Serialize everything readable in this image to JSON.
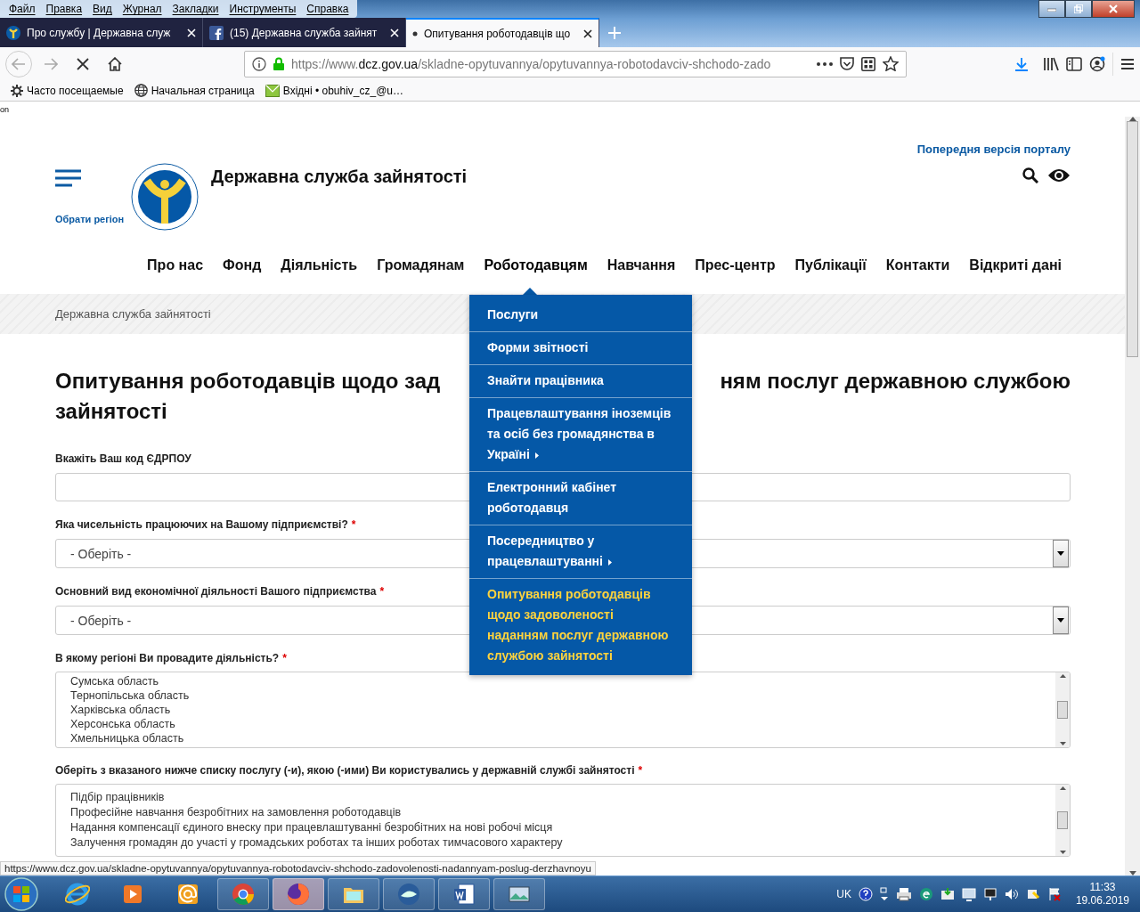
{
  "menu_bar": [
    "Файл",
    "Правка",
    "Вид",
    "Журнал",
    "Закладки",
    "Инструменты",
    "Справка"
  ],
  "browser_tabs": [
    {
      "title": "Про службу | Державна служ",
      "kind": "site",
      "selected": false
    },
    {
      "title": "(15) Державна служба зайнят",
      "kind": "facebook",
      "selected": false
    },
    {
      "title": "Опитування роботодавців що",
      "kind": "loading",
      "selected": true
    }
  ],
  "address_bar": {
    "scheme": "https://www.",
    "domain": "dcz.gov.ua",
    "path": "/skladne-opytuvannya/opytuvannya-robotodavciv-shchodo-zado"
  },
  "bookmarks": [
    {
      "label": "Часто посещаемые",
      "kind": "gear"
    },
    {
      "label": "Начальная страница",
      "kind": "globe"
    },
    {
      "label": "Вхідні • obuhiv_cz_@u…",
      "kind": "mail"
    }
  ],
  "page_corner_text": "on",
  "site": {
    "previous_version_link": "Попередня версія порталу",
    "title": "Державна служба зайнятості",
    "region_link": "Обрати регіон",
    "nav": [
      {
        "label": "Про нас",
        "expanded": false
      },
      {
        "label": "Фонд",
        "expanded": false
      },
      {
        "label": "Діяльність",
        "expanded": false
      },
      {
        "label": "Громадянам",
        "expanded": false
      },
      {
        "label": "Роботодавцям",
        "expanded": true
      },
      {
        "label": "Навчання",
        "expanded": false
      },
      {
        "label": "Прес-центр",
        "expanded": false
      },
      {
        "label": "Публікації",
        "expanded": false
      },
      {
        "label": "Контакти",
        "expanded": false
      },
      {
        "label": "Відкриті дані",
        "expanded": false
      }
    ],
    "breadcrumb": "Державна служба зайнятості"
  },
  "dropdown_menu": [
    {
      "label": "Послуги",
      "has_submenu": false,
      "selected": false
    },
    {
      "label": "Форми звітності",
      "has_submenu": false,
      "selected": false
    },
    {
      "label": "Знайти працівника",
      "has_submenu": false,
      "selected": false
    },
    {
      "label": "Працевлаштування іноземців та осіб без громадянства в Україні",
      "has_submenu": true,
      "selected": false
    },
    {
      "label": "Електронний кабінет роботодавця",
      "has_submenu": false,
      "selected": false
    },
    {
      "label": "Посередництво у працевлаштуванні",
      "has_submenu": true,
      "selected": false
    },
    {
      "label": "Опитування роботодавців щодо задоволеності наданням послуг державною службою зайнятості",
      "has_submenu": false,
      "selected": true
    }
  ],
  "heading_parts": [
    "Опитування роботодавців щодо зад",
    "ням послуг державною службою",
    "зайнятості"
  ],
  "form_fields": [
    {
      "kind": "text",
      "label": "Вкажіть Ваш код ЄДРПОУ",
      "required": false
    },
    {
      "kind": "select",
      "label": "Яка чисельність працюючих на Вашому підприємстві?",
      "required": true,
      "value": "- Оберіть -"
    },
    {
      "kind": "select",
      "label": "Основний вид економічної діяльності Вашого підприємства",
      "required": true,
      "value": "- Оберіть -"
    },
    {
      "kind": "listbox",
      "label": "В якому регіоні Ви провадите діяльність?",
      "required": true,
      "options": [
        "Сумська область",
        "Тернопільська область",
        "Харківська область",
        "Херсонська область",
        "Хмельницька область"
      ]
    },
    {
      "kind": "listbox",
      "label": "Оберіть з вказаного нижче списку послугу (-и), якою (-ими) Ви користувались у державній службі зайнятості",
      "required": true,
      "options": [
        "Підбір працівників",
        "Професійне навчання безробітних на замовлення роботодавців",
        "Надання компенсації єдиного внеску при працевлаштуванні безробітних на нові робочі місця",
        "Залучення громадян до участі у громадських роботах та інших роботах тимчасового характеру"
      ]
    }
  ],
  "required_mark": "*",
  "status_url": "https://www.dcz.gov.ua/skladne-opytuvannya/opytuvannya-robotodavciv-shchodo-zadovolenosti-nadannyam-poslug-derzhavnoyu",
  "taskbar": {
    "language": "UK",
    "time": "11:33",
    "date": "19.06.2019"
  }
}
